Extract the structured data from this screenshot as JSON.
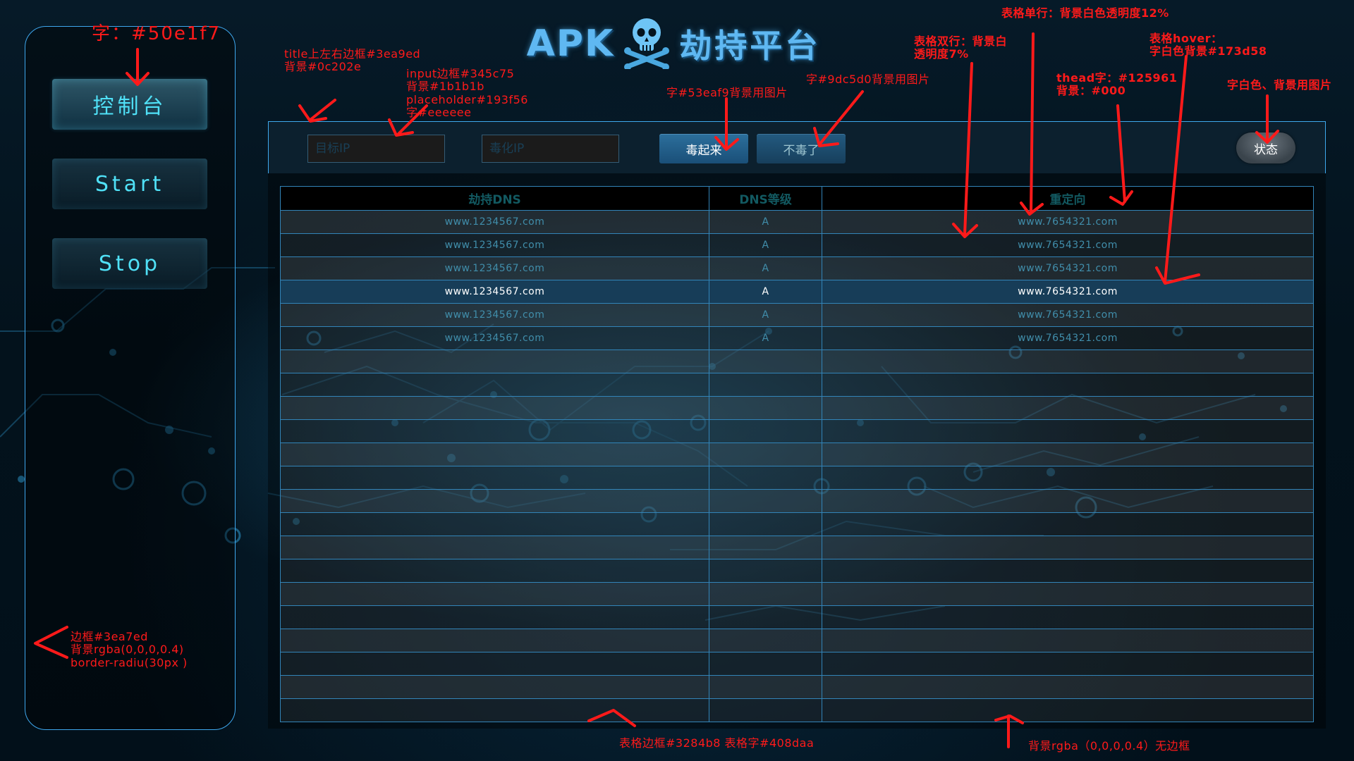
{
  "title": {
    "apk": "APK",
    "text": "劫持平台"
  },
  "sidebar": {
    "items": [
      {
        "label": "控制台"
      },
      {
        "label": "Start"
      },
      {
        "label": "Stop"
      }
    ]
  },
  "toolbar": {
    "target_ip_placeholder": "目标IP",
    "poison_ip_placeholder": "毒化IP",
    "poison_button": "毒起来",
    "unpoison_button": "不毒了",
    "status_button": "状态"
  },
  "table": {
    "headers": [
      "劫持DNS",
      "DNS等级",
      "重定向"
    ],
    "rows": [
      [
        "www.1234567.com",
        "A",
        "www.7654321.com"
      ],
      [
        "www.1234567.com",
        "A",
        "www.7654321.com"
      ],
      [
        "www.1234567.com",
        "A",
        "www.7654321.com"
      ],
      [
        "www.1234567.com",
        "A",
        "www.7654321.com"
      ],
      [
        "www.1234567.com",
        "A",
        "www.7654321.com"
      ],
      [
        "www.1234567.com",
        "A",
        "www.7654321.com"
      ],
      [
        "",
        "",
        ""
      ],
      [
        "",
        "",
        ""
      ],
      [
        "",
        "",
        ""
      ],
      [
        "",
        "",
        ""
      ],
      [
        "",
        "",
        ""
      ],
      [
        "",
        "",
        ""
      ],
      [
        "",
        "",
        ""
      ],
      [
        "",
        "",
        ""
      ],
      [
        "",
        "",
        ""
      ],
      [
        "",
        "",
        ""
      ],
      [
        "",
        "",
        ""
      ],
      [
        "",
        "",
        ""
      ],
      [
        "",
        "",
        ""
      ],
      [
        "",
        "",
        ""
      ],
      [
        "",
        "",
        ""
      ],
      [
        "",
        "",
        ""
      ]
    ]
  },
  "annotations": {
    "sidebar_text_color": "字：#50e1f7",
    "toolbar_border": "title上左右边框#3ea9ed\n背景#0c202e",
    "input_style": "input边框#345c75\n背景#1b1b1b\nplaceholder#193f56\n字#eeeeee",
    "poison_btn": "字#53eaf9背景用图片",
    "unpoison_btn": "字#9dc5d0背景用图片",
    "double_row": "表格双行：背景白\n透明度7%",
    "single_row": "表格单行：背景白色透明度12%",
    "hover_row": "表格hover：\n字白色背景#173d58",
    "thead": "thead字：#125961\n背景：#000",
    "status_btn": "字白色、背景用图片",
    "sidebar_box": "边框#3ea7ed\n背景rgba(0,0,0,0.4)\nborder-radiu(30px )",
    "table_border": "表格边框#3284b8 表格字#408daa",
    "panel_bg": "背景rgba（0,0,0,0.4）无边框"
  },
  "colors": {
    "sidebar_text": "#50e1f7",
    "sidebar_border": "#3ea7ed",
    "toolbar_border": "#3ea9ed",
    "toolbar_bg": "#0c202e",
    "input_border": "#345c75",
    "input_bg": "#1b1b1b",
    "placeholder": "#193f56",
    "thead_text": "#125961",
    "table_border": "#3284b8",
    "table_text": "#408daa",
    "hover_bg": "#173d58",
    "annotation": "#ff1a1a"
  },
  "icons": {
    "title_logo": "skull-crossbones-icon"
  }
}
